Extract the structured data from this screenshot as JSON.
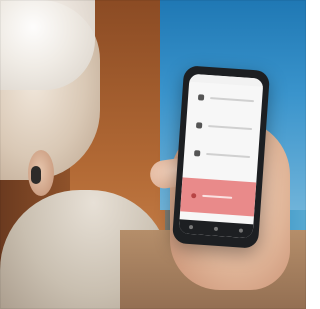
{
  "scene": {
    "subject": "",
    "device": "",
    "screen_theme": "light",
    "alert_color": "#e98a8a"
  },
  "phone": {
    "rows": [
      {
        "icon": "bell-icon"
      },
      {
        "icon": "lock-icon"
      },
      {
        "icon": "person-icon"
      }
    ],
    "alert": {
      "icon": "alert-icon"
    },
    "nav": [
      {
        "icon": "back-icon"
      },
      {
        "icon": "home-icon"
      },
      {
        "icon": "recent-icon"
      }
    ]
  }
}
